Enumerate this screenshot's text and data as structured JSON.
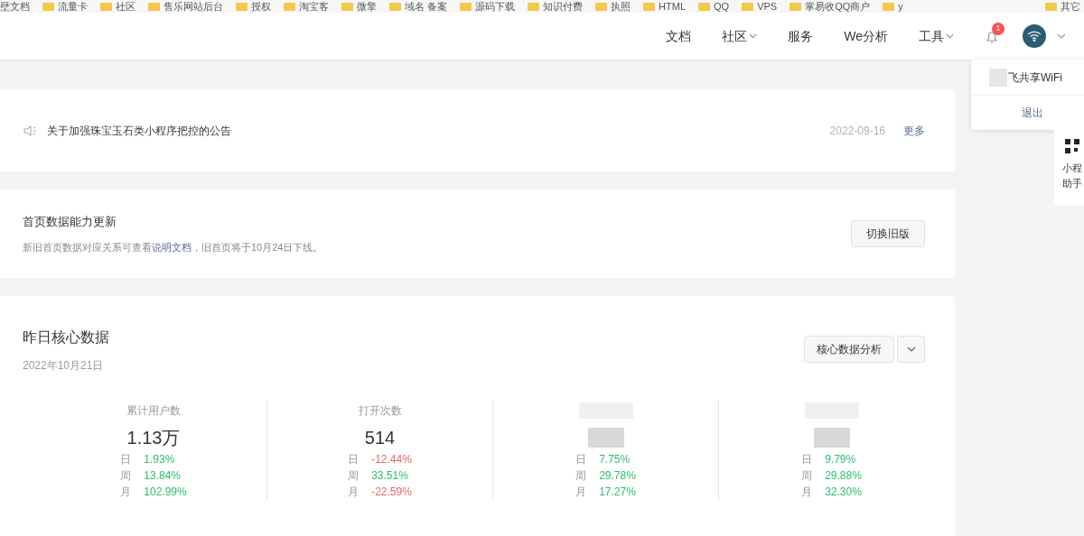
{
  "bookmarks": [
    "壁文档",
    "流量卡",
    "社区",
    "售乐网站后台",
    "授权",
    "淘宝客",
    "微擎",
    "域名 备案",
    "源码下载",
    "知识付费",
    "执照",
    "HTML",
    "QQ",
    "VPS",
    "掌易收QQ商户",
    "y"
  ],
  "bookmarks_right": "其它",
  "nav": [
    {
      "label": "文档",
      "dropdown": false
    },
    {
      "label": "社区",
      "dropdown": true
    },
    {
      "label": "服务",
      "dropdown": false
    },
    {
      "label": "We分析",
      "dropdown": false
    },
    {
      "label": "工具",
      "dropdown": true
    }
  ],
  "notifications": {
    "count": "1"
  },
  "account_menu": {
    "name": "飞共享WiFi",
    "logout": "退出"
  },
  "side_panel": {
    "lines": [
      "小程",
      "助手"
    ]
  },
  "notice": {
    "title": "关于加强珠宝玉石类小程序把控的公告",
    "date": "2022-09-16",
    "more": "更多"
  },
  "update": {
    "title": "首页数据能力更新",
    "text_before": "新旧首页数据对应关系可查看",
    "link": "说明文档",
    "text_after": "，旧首页将于10月24日下线。",
    "button": "切换旧版"
  },
  "core": {
    "title": "昨日核心数据",
    "date": "2022年10月21日",
    "button": "核心数据分析",
    "metrics": [
      {
        "label": "累计用户数",
        "value": "1.13万",
        "changes": [
          {
            "period": "日",
            "value": "1.93%",
            "color": "#2bbd6c"
          },
          {
            "period": "周",
            "value": "13.84%",
            "color": "#2bbd6c"
          },
          {
            "period": "月",
            "value": "102.99%",
            "color": "#2bbd6c"
          }
        ]
      },
      {
        "label": "打开次数",
        "value": "514",
        "changes": [
          {
            "period": "日",
            "value": "-12.44%",
            "color": "#e0696b"
          },
          {
            "period": "周",
            "value": "33.51%",
            "color": "#2bbd6c"
          },
          {
            "period": "月",
            "value": "-22.59%",
            "color": "#e0696b"
          }
        ]
      },
      {
        "changes": [
          {
            "period": "日",
            "value": "7.75%",
            "color": "#2bbd6c"
          },
          {
            "period": "周",
            "value": "29.78%",
            "color": "#2bbd6c"
          },
          {
            "period": "月",
            "value": "17.27%",
            "color": "#2bbd6c"
          }
        ]
      },
      {
        "changes": [
          {
            "period": "日",
            "value": "9.79%",
            "color": "#2bbd6c"
          },
          {
            "period": "周",
            "value": "29.88%",
            "color": "#2bbd6c"
          },
          {
            "period": "月",
            "value": "32.30%",
            "color": "#2bbd6c"
          }
        ]
      }
    ]
  }
}
